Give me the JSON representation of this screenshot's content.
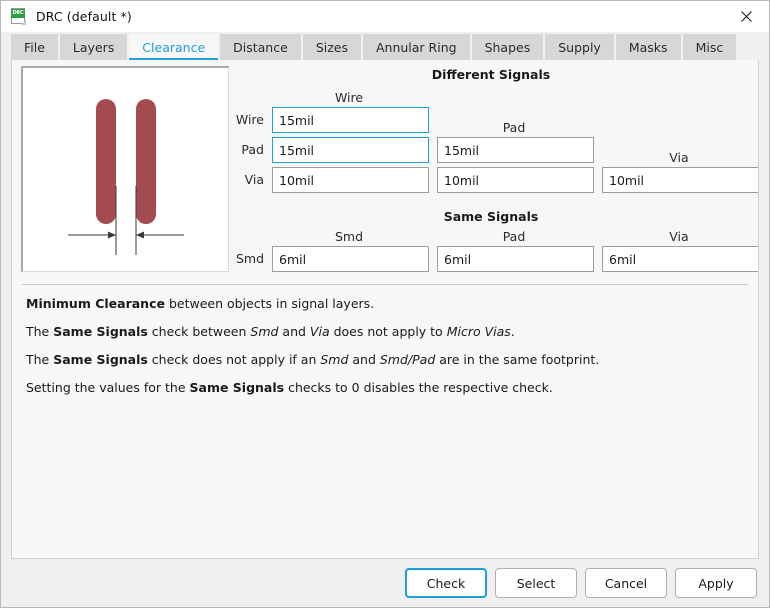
{
  "window": {
    "title": "DRC (default *)",
    "icon": "drc-document-icon",
    "icon_text": "DRC",
    "close_label": "✕"
  },
  "tabs": [
    {
      "label": "File",
      "active": false
    },
    {
      "label": "Layers",
      "active": false
    },
    {
      "label": "Clearance",
      "active": true
    },
    {
      "label": "Distance",
      "active": false
    },
    {
      "label": "Sizes",
      "active": false
    },
    {
      "label": "Annular Ring",
      "active": false
    },
    {
      "label": "Shapes",
      "active": false
    },
    {
      "label": "Supply",
      "active": false
    },
    {
      "label": "Masks",
      "active": false
    },
    {
      "label": "Misc",
      "active": false
    }
  ],
  "preview": {
    "alt": "clearance-preview-two-traces",
    "trace_color": "#a44b4f",
    "background": "#ffffff"
  },
  "different_signals": {
    "title": "Different Signals",
    "col_headers": [
      "Wire",
      "Pad",
      "Via"
    ],
    "row_labels": [
      "Wire",
      "Pad",
      "Via"
    ],
    "values": {
      "wire_wire": "15mil",
      "pad_wire": "15mil",
      "pad_pad": "15mil",
      "via_wire": "10mil",
      "via_pad": "10mil",
      "via_via": "10mil"
    }
  },
  "same_signals": {
    "title": "Same Signals",
    "col_headers": [
      "Smd",
      "Pad",
      "Via"
    ],
    "row_labels": [
      "Smd"
    ],
    "values": {
      "smd_smd": "6mil",
      "smd_pad": "6mil",
      "smd_via": "6mil"
    }
  },
  "notes": [
    {
      "parts": [
        {
          "text": "Minimum Clearance",
          "style": "bold"
        },
        {
          "text": " between objects in signal layers.",
          "style": "normal"
        }
      ]
    },
    {
      "parts": [
        {
          "text": "The ",
          "style": "normal"
        },
        {
          "text": "Same Signals",
          "style": "bold"
        },
        {
          "text": " check between ",
          "style": "normal"
        },
        {
          "text": "Smd",
          "style": "italic"
        },
        {
          "text": " and ",
          "style": "normal"
        },
        {
          "text": "Via",
          "style": "italic"
        },
        {
          "text": " does not apply to ",
          "style": "normal"
        },
        {
          "text": "Micro Vias",
          "style": "italic"
        },
        {
          "text": ".",
          "style": "normal"
        }
      ]
    },
    {
      "parts": [
        {
          "text": "The ",
          "style": "normal"
        },
        {
          "text": "Same Signals",
          "style": "bold"
        },
        {
          "text": " check does not apply if an ",
          "style": "normal"
        },
        {
          "text": "Smd",
          "style": "italic"
        },
        {
          "text": " and ",
          "style": "normal"
        },
        {
          "text": "Smd/Pad",
          "style": "italic"
        },
        {
          "text": " are in the same footprint.",
          "style": "normal"
        }
      ]
    },
    {
      "parts": [
        {
          "text": "Setting the values for the ",
          "style": "normal"
        },
        {
          "text": "Same Signals",
          "style": "bold"
        },
        {
          "text": " checks to 0 disables the respective check.",
          "style": "normal"
        }
      ]
    }
  ],
  "footer": {
    "buttons": [
      {
        "label": "Check",
        "default": true
      },
      {
        "label": "Select",
        "default": false
      },
      {
        "label": "Cancel",
        "default": false
      },
      {
        "label": "Apply",
        "default": false
      }
    ]
  },
  "colors": {
    "accent": "#1e9fd8",
    "trace": "#a44b4f",
    "tab_inactive": "#d7d7d7",
    "panel_bg": "#f7f7f7"
  }
}
